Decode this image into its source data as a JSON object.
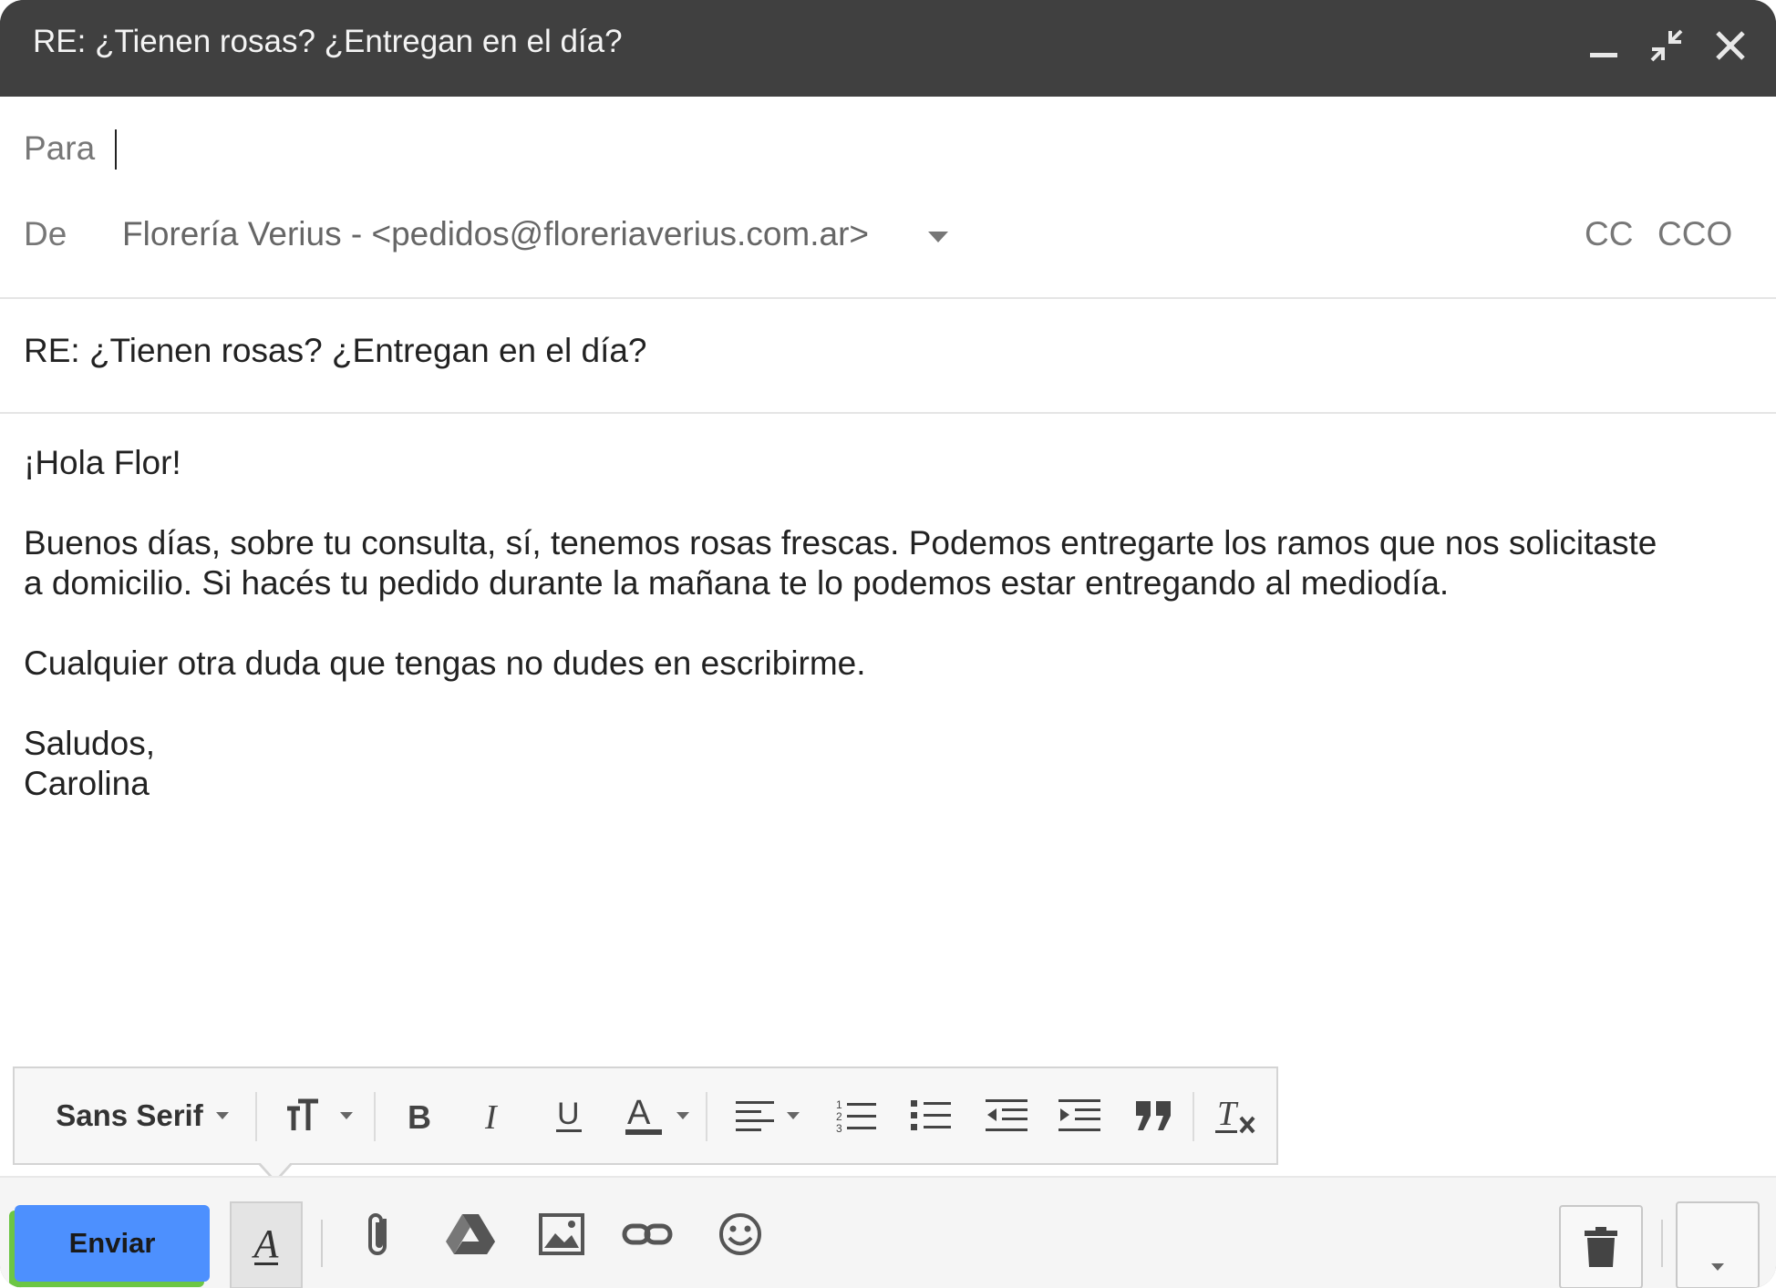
{
  "window": {
    "title": "RE: ¿Tienen rosas? ¿Entregan en el día?",
    "minimize_icon": "minimize-icon",
    "popout_icon": "exit-fullscreen-icon",
    "close_icon": "close-icon"
  },
  "compose": {
    "to_label": "Para",
    "from_label": "De",
    "from_value": "Florería Verius - <pedidos@floreriaverius.com.ar>",
    "cc_label": "CC",
    "bcc_label": "CCO",
    "subject": "RE: ¿Tienen rosas? ¿Entregan en el día?",
    "body": {
      "greeting": "¡Hola Flor!",
      "line1": "Buenos días, sobre tu consulta, sí, tenemos rosas frescas. Podemos entregarte los ramos que nos solicitaste",
      "line2": "a domicilio. Si hacés tu pedido durante la mañana te lo podemos estar entregando al mediodía.",
      "line3": "Cualquier otra duda que tengas no dudes en escribirme.",
      "closing": "Saludos,",
      "signature": "Carolina"
    }
  },
  "format_toolbar": {
    "font_family": "Sans Serif",
    "icons": [
      "font-size-icon",
      "bold-icon",
      "italic-icon",
      "underline-icon",
      "text-color-icon",
      "align-icon",
      "numbered-list-icon",
      "bulleted-list-icon",
      "indent-less-icon",
      "indent-more-icon",
      "quote-icon",
      "remove-formatting-icon"
    ]
  },
  "bottom_toolbar": {
    "send_label": "Enviar",
    "icons": [
      "formatting-options-icon",
      "attach-icon",
      "drive-icon",
      "insert-photo-icon",
      "insert-link-icon",
      "emoji-icon",
      "trash-icon",
      "more-options-icon"
    ]
  },
  "colors": {
    "titlebar": "#404040",
    "send_button": "#4d90fe",
    "send_shadow": "#6cc644"
  }
}
